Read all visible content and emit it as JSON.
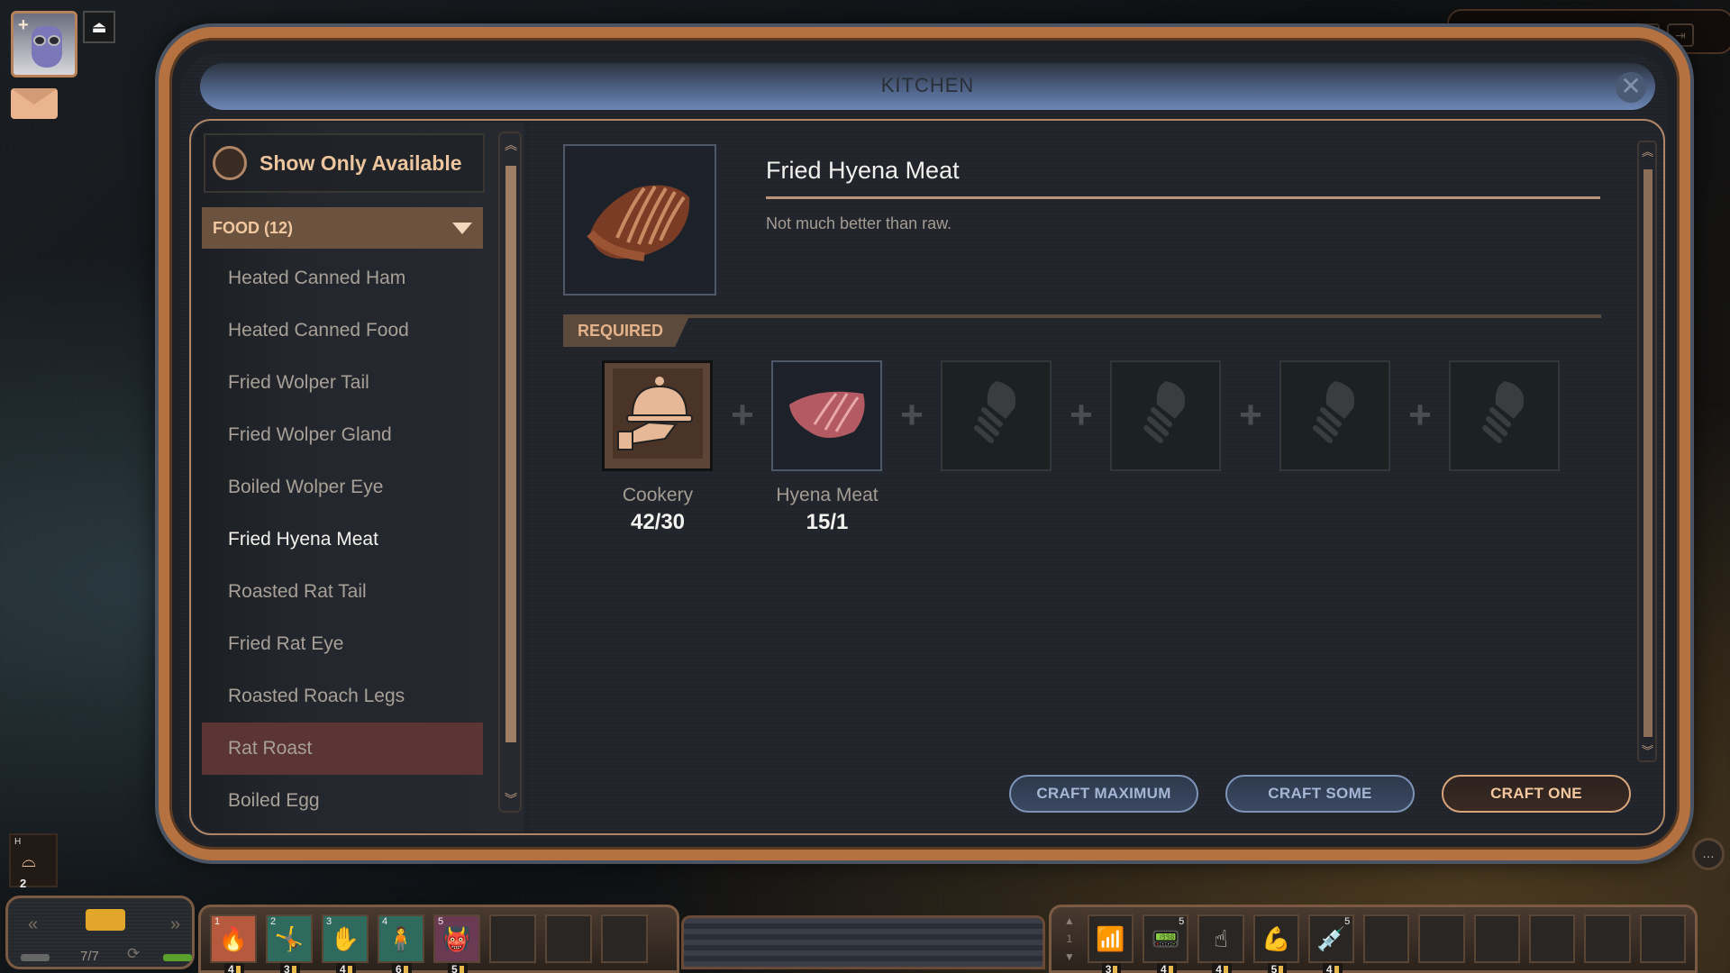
{
  "hud": {
    "portrait_plus": "+",
    "weight_icon": "⏏",
    "top_toolbar_icons": [
      "character-icon",
      "inventory-icon",
      "skills-icon",
      "journal-icon",
      "map-icon",
      "camp-icon",
      "exit-icon"
    ],
    "top_toolbar_glyphs": [
      "●",
      "▭",
      "▯",
      "▥",
      "◉",
      "┼",
      "⇥"
    ],
    "headgear_slot": {
      "hotkey": "H",
      "icon": "mask-icon",
      "glyph": "🎭",
      "count": "2"
    },
    "weapon": {
      "ammo": "7/7",
      "prev": "«",
      "next": "»",
      "reload_glyph": "⟳"
    },
    "hotbar_left": [
      {
        "num": "1",
        "glyph": "🔥",
        "color": "#b55a3e",
        "cost": "4"
      },
      {
        "num": "2",
        "glyph": "🤸",
        "color": "#2f6a5e",
        "cost": "3"
      },
      {
        "num": "3",
        "glyph": "✋",
        "color": "#2f6a5e",
        "cost": "4"
      },
      {
        "num": "4",
        "glyph": "🧍",
        "color": "#2f6a5e",
        "cost": "6"
      },
      {
        "num": "5",
        "glyph": "👹",
        "color": "#6a3a52",
        "cost": "5"
      },
      {
        "num": "",
        "glyph": "",
        "color": "#2a2624",
        "cost": ""
      },
      {
        "num": "",
        "glyph": "",
        "color": "#2a2624",
        "cost": ""
      },
      {
        "num": "",
        "glyph": "",
        "color": "#2a2624",
        "cost": ""
      }
    ],
    "hotbar_right_page": "1",
    "hotbar_right": [
      {
        "glyph": "📶",
        "badge": "",
        "cost": "3"
      },
      {
        "glyph": "📟",
        "badge": "5",
        "cost": "4"
      },
      {
        "glyph": "☝",
        "badge": "",
        "cost": "4"
      },
      {
        "glyph": "💪",
        "badge": "",
        "cost": "5"
      },
      {
        "glyph": "💉",
        "badge": "5",
        "cost": "4"
      },
      {
        "glyph": "",
        "badge": "",
        "cost": ""
      },
      {
        "glyph": "",
        "badge": "",
        "cost": ""
      },
      {
        "glyph": "",
        "badge": "",
        "cost": ""
      },
      {
        "glyph": "",
        "badge": "",
        "cost": ""
      },
      {
        "glyph": "",
        "badge": "",
        "cost": ""
      },
      {
        "glyph": "",
        "badge": "",
        "cost": ""
      }
    ],
    "chat_glyph": "…"
  },
  "window": {
    "title": "KITCHEN",
    "close_glyph": "✕"
  },
  "filter": {
    "show_only_available_label": "Show Only Available",
    "checked": false
  },
  "category": {
    "label": "FOOD (12)"
  },
  "recipes": [
    {
      "label": "Heated Canned Ham",
      "state": "normal"
    },
    {
      "label": "Heated Canned Food",
      "state": "normal"
    },
    {
      "label": "Fried Wolper Tail",
      "state": "normal"
    },
    {
      "label": "Fried Wolper Gland",
      "state": "normal"
    },
    {
      "label": "Boiled Wolper Eye",
      "state": "normal"
    },
    {
      "label": "Fried Hyena Meat",
      "state": "selected"
    },
    {
      "label": "Roasted Rat Tail",
      "state": "normal"
    },
    {
      "label": "Fried Rat Eye",
      "state": "normal"
    },
    {
      "label": "Roasted Roach Legs",
      "state": "normal"
    },
    {
      "label": "Rat Roast",
      "state": "hover"
    },
    {
      "label": "Boiled Egg",
      "state": "normal"
    }
  ],
  "scroll": {
    "up": "︽",
    "down": "︾"
  },
  "detail": {
    "name": "Fried Hyena Meat",
    "description": "Not much better than raw.",
    "required_label": "REQUIRED",
    "requirements": [
      {
        "type": "skill",
        "label": "Cookery",
        "count": "42/30",
        "icon": "cloche-icon"
      },
      {
        "type": "ingredient",
        "label": "Hyena Meat",
        "count": "15/1",
        "icon": "raw-meat-icon"
      },
      {
        "type": "empty",
        "label": "",
        "count": "",
        "icon": "screw-icon"
      },
      {
        "type": "empty",
        "label": "",
        "count": "",
        "icon": "screw-icon"
      },
      {
        "type": "empty",
        "label": "",
        "count": "",
        "icon": "screw-icon"
      },
      {
        "type": "empty",
        "label": "",
        "count": "",
        "icon": "screw-icon"
      }
    ],
    "plus_glyph": "+"
  },
  "actions": {
    "craft_maximum": "CRAFT MAXIMUM",
    "craft_some": "CRAFT SOME",
    "craft_one": "CRAFT ONE"
  },
  "colors": {
    "accent_copper": "#b08666",
    "title_bar_blue": "#6d86b4",
    "hover_row": "#5a3534",
    "category_bg": "#6b5340"
  }
}
